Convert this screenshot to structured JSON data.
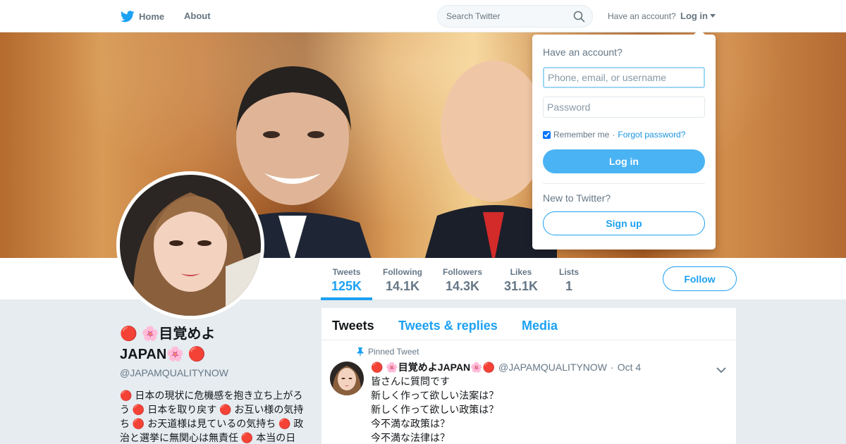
{
  "nav": {
    "home_label": "Home",
    "about_label": "About",
    "search_placeholder": "Search Twitter",
    "have_account": "Have an account?",
    "login_label": "Log in"
  },
  "profile": {
    "name_line1": "🔴 🌸目覚めよ",
    "name_line2": "JAPAN🌸 🔴",
    "handle": "@JAPAMQUALITYNOW",
    "bio": "🔴 日本の現状に危機感を抱き立ち上がろう 🔴 日本を取り戻す 🔴 お互い様の気持ち 🔴 お天道様は見ているの気持ち 🔴 政治と選挙に無関心は無責任 🔴 本当の日本"
  },
  "stats": [
    {
      "label": "Tweets",
      "value": "125K"
    },
    {
      "label": "Following",
      "value": "14.1K"
    },
    {
      "label": "Followers",
      "value": "14.3K"
    },
    {
      "label": "Likes",
      "value": "31.1K"
    },
    {
      "label": "Lists",
      "value": "1"
    }
  ],
  "follow_label": "Follow",
  "tabs": [
    "Tweets",
    "Tweets & replies",
    "Media"
  ],
  "tweet": {
    "pinned_label": "Pinned Tweet",
    "name": "🔴 🌸目覚めよJAPAN🌸🔴",
    "handle": "@JAPAMQUALITYNOW",
    "dot": "·",
    "time": "Oct 4",
    "lines": [
      "皆さんに質問です",
      "新しく作って欲しい法案は？",
      "新しく作って欲しい政策は？",
      "今不満な政策は？",
      "今不満な法律は？"
    ]
  },
  "login_dropdown": {
    "title": "Have an account?",
    "username_placeholder": "Phone, email, or username",
    "password_placeholder": "Password",
    "remember_label": "Remember me",
    "separator": "·",
    "forgot_label": "Forgot password?",
    "login_button": "Log in",
    "new_label": "New to Twitter?",
    "signup_button": "Sign up"
  },
  "colors": {
    "accent": "#1da1f2",
    "login_button_bg": "#4ab3f4",
    "background": "#e6ecf0"
  }
}
